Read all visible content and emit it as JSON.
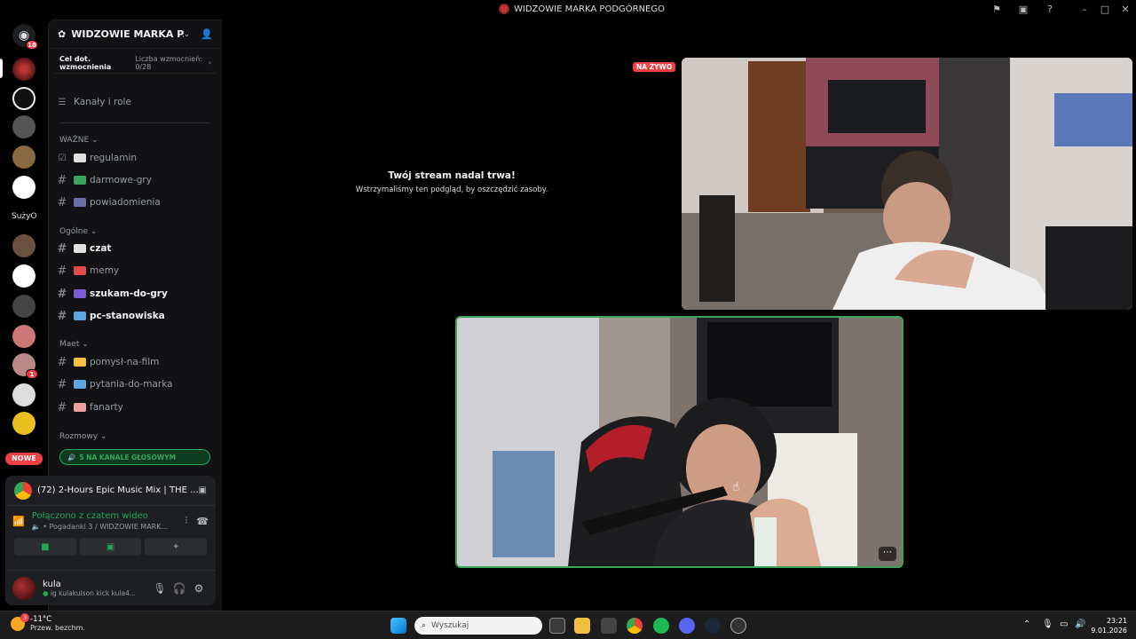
{
  "window": {
    "title": "WIDZOWIE MARKA PODGÓRNEGO"
  },
  "rail": {
    "home_badge": "18",
    "server_badge": "1",
    "text_server_label": "SużyO",
    "new_badge": "NOWE"
  },
  "server": {
    "name": "WIDZOWIE MARKA P...",
    "boost_goal_label": "Cel dot. wzmocnienia",
    "boost_count": "Liczba wzmocnień: 0/28",
    "channels_and_roles": "Kanały i role"
  },
  "categories": {
    "wazne": "WAŻNE",
    "ogolne": "Ogólne",
    "maet": "Maet",
    "rozmowy": "Rozmowy"
  },
  "channels": [
    {
      "name": "regulamin",
      "emoji_color": "#e0e0e0"
    },
    {
      "name": "darmowe-gry",
      "emoji_color": "#3ba55d"
    },
    {
      "name": "powiadomienia",
      "emoji_color": "#6b6fa8"
    },
    {
      "name": "czat",
      "emoji_color": "#e0e0e0"
    },
    {
      "name": "memy",
      "emoji_color": "#e04a4a"
    },
    {
      "name": "szukam-do-gry",
      "emoji_color": "#7b5cd6"
    },
    {
      "name": "pc-stanowiska",
      "emoji_color": "#5aa7e0"
    },
    {
      "name": "pomysł-na-film",
      "emoji_color": "#f5c043"
    },
    {
      "name": "pytania-do-marka",
      "emoji_color": "#5aa7e0"
    },
    {
      "name": "fanarty",
      "emoji_color": "#e8a0a0"
    }
  ],
  "voice_banner": "5 NA KANALE GŁOSOWYM",
  "activity": {
    "title": "(72) 2-Hours Epic Music Mix | THE ..."
  },
  "rtc": {
    "status": "Połączono z czatem wideo",
    "channel": "Pogadanki 3 / WIDZOWIE MARK..."
  },
  "user": {
    "name": "kula",
    "status": "ig kulakulson kick kula4..."
  },
  "stage": {
    "paused_title": "Twój stream nadal trwa!",
    "paused_sub": "Wstrzymaliśmy ten podgląd, by oszczędzić zasoby.",
    "live_badge": "NA ŻYWO"
  },
  "taskbar": {
    "weather_temp": "-11°C",
    "weather_desc": "Przew. bezchm.",
    "weather_badge": "3",
    "search_placeholder": "Wyszukaj",
    "time": "23:21",
    "date": "9.01.2026"
  },
  "colors": {
    "accent_green": "#23a55a",
    "live_red": "#f23f43",
    "background": "#000000"
  }
}
